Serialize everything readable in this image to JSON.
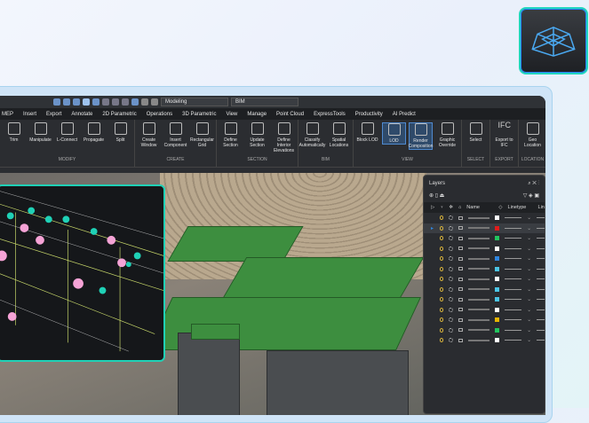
{
  "toolbar": {
    "workspace": "Modeling",
    "profile": "BIM"
  },
  "menu": [
    "MEP",
    "Insert",
    "Export",
    "Annotate",
    "2D Parametric",
    "Operations",
    "3D Parametric",
    "View",
    "Manage",
    "Point Cloud",
    "ExpressTools",
    "Productivity",
    "AI Predict"
  ],
  "ribbon": [
    {
      "group": "MODIFY",
      "tools": [
        "Trim",
        "Manipulate",
        "L-Connect",
        "Propagate",
        "Split"
      ]
    },
    {
      "group": "CREATE",
      "tools": [
        "Create Window",
        "Insert Component",
        "Rectangular Grid"
      ]
    },
    {
      "group": "SECTION",
      "tools": [
        "Define Section",
        "Update Section",
        "Define Interior Elevations"
      ]
    },
    {
      "group": "BIM",
      "tools": [
        "Classify Automatically",
        "Spatial Locations"
      ]
    },
    {
      "group": "VIEW",
      "tools": [
        "Block LOD",
        "LOD",
        "Render Composition",
        "Graphic Override"
      ]
    },
    {
      "group": "SELECT",
      "tools": [
        "Select"
      ]
    },
    {
      "group": "EXPORT",
      "tools": [
        "Export to IFC"
      ]
    },
    {
      "group": "LOCATION",
      "tools": [
        "Geo Location"
      ]
    }
  ],
  "ifc_label": "IFC",
  "layers": {
    "title": "Layers",
    "columns": [
      "Name",
      "Linetype",
      "Lin"
    ],
    "colors": [
      "#ffffff",
      "#e01b1b",
      "#22c55e",
      "#ffffff",
      "#2f86e0",
      "#4cc6e6",
      "#ffffff",
      "#4cc6e6",
      "#4cc6e6",
      "#ffffff",
      "#e5b400",
      "#22c55e",
      "#ffffff"
    ],
    "selected_row": 1
  },
  "colors": {
    "accent": "#1fd1b6",
    "brand_blue": "#2a7cf5"
  }
}
